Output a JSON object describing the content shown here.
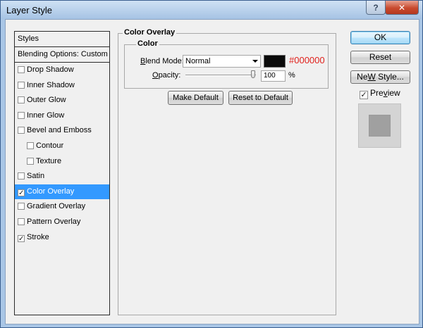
{
  "window": {
    "title": "Layer Style",
    "help_glyph": "?",
    "close_glyph": "✕"
  },
  "style_list": {
    "header": "Styles",
    "blending_options": "Blending Options: Custom",
    "items": [
      {
        "label": "Drop Shadow",
        "checked": false,
        "sub": false,
        "selected": false
      },
      {
        "label": "Inner Shadow",
        "checked": false,
        "sub": false,
        "selected": false
      },
      {
        "label": "Outer Glow",
        "checked": false,
        "sub": false,
        "selected": false
      },
      {
        "label": "Inner Glow",
        "checked": false,
        "sub": false,
        "selected": false
      },
      {
        "label": "Bevel and Emboss",
        "checked": false,
        "sub": false,
        "selected": false
      },
      {
        "label": "Contour",
        "checked": false,
        "sub": true,
        "selected": false
      },
      {
        "label": "Texture",
        "checked": false,
        "sub": true,
        "selected": false
      },
      {
        "label": "Satin",
        "checked": false,
        "sub": false,
        "selected": false
      },
      {
        "label": "Color Overlay",
        "checked": true,
        "sub": false,
        "selected": true
      },
      {
        "label": "Gradient Overlay",
        "checked": false,
        "sub": false,
        "selected": false
      },
      {
        "label": "Pattern Overlay",
        "checked": false,
        "sub": false,
        "selected": false
      },
      {
        "label": "Stroke",
        "checked": true,
        "sub": false,
        "selected": false
      }
    ]
  },
  "panel": {
    "outer_title": "Color Overlay",
    "inner_title": "Color",
    "blend_mode_label_underlined": "B",
    "blend_mode_label_rest": "lend Mode:",
    "blend_mode_value": "Normal",
    "swatch_color": "#0a0a0a",
    "hex_value": "#000000",
    "opacity_label_underlined": "O",
    "opacity_label_rest": "pacity:",
    "opacity_value": "100",
    "opacity_unit": "%",
    "opacity_level": 1.0,
    "make_default": "Make Default",
    "reset_default": "Reset to Default"
  },
  "actions": {
    "ok": "OK",
    "reset": "Reset",
    "new_style_underlined": "W",
    "new_style_prefix": "Ne",
    "new_style_suffix": " Style...",
    "preview_underlined": "v",
    "preview_prefix": "Pre",
    "preview_suffix": "iew",
    "preview_checked": true
  }
}
